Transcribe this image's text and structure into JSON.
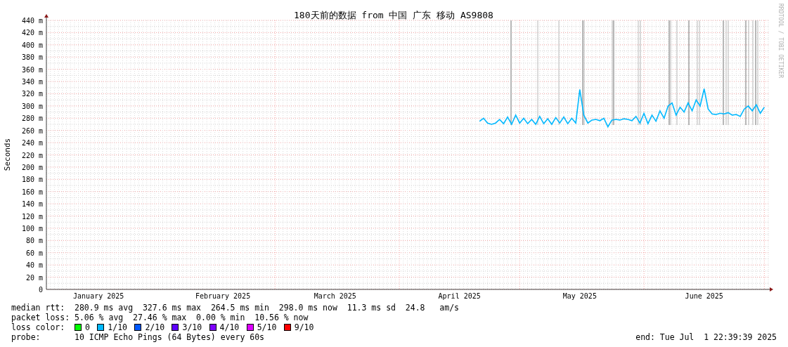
{
  "graph": {
    "credit": "RRDTOOL / TOBI OETIKER",
    "chart_data": {
      "type": "line",
      "grid": true,
      "title": "180天前的数据 from 中国 广东 移动 AS9808",
      "ylabel": "Seconds",
      "ylim": [
        0,
        440
      ],
      "yticks": [
        {
          "value": 0,
          "label": "0"
        },
        {
          "value": 20,
          "label": "20 m"
        },
        {
          "value": 40,
          "label": "40 m"
        },
        {
          "value": 60,
          "label": "60 m"
        },
        {
          "value": 80,
          "label": "80 m"
        },
        {
          "value": 100,
          "label": "100 m"
        },
        {
          "value": 120,
          "label": "120 m"
        },
        {
          "value": 140,
          "label": "140 m"
        },
        {
          "value": 160,
          "label": "160 m"
        },
        {
          "value": 180,
          "label": "180 m"
        },
        {
          "value": 200,
          "label": "200 m"
        },
        {
          "value": 220,
          "label": "220 m"
        },
        {
          "value": 240,
          "label": "240 m"
        },
        {
          "value": 260,
          "label": "260 m"
        },
        {
          "value": 280,
          "label": "280 m"
        },
        {
          "value": 300,
          "label": "300 m"
        },
        {
          "value": 320,
          "label": "320 m"
        },
        {
          "value": 340,
          "label": "340 m"
        },
        {
          "value": 360,
          "label": "360 m"
        },
        {
          "value": 380,
          "label": "380 m"
        },
        {
          "value": 400,
          "label": "400 m"
        },
        {
          "value": 420,
          "label": "420 m"
        },
        {
          "value": 440,
          "label": "440 m"
        }
      ],
      "categories": [
        null,
        null,
        null,
        null,
        null,
        null,
        null,
        null,
        null,
        null,
        null,
        null,
        null,
        "January 2025",
        null,
        null,
        null,
        null,
        null,
        null,
        null,
        null,
        null,
        null,
        null,
        null,
        null,
        null,
        null,
        null,
        null,
        null,
        null,
        null,
        null,
        null,
        null,
        null,
        null,
        null,
        null,
        null,
        null,
        null,
        "February 2025",
        null,
        null,
        null,
        null,
        null,
        null,
        null,
        null,
        null,
        null,
        null,
        null,
        null,
        null,
        null,
        null,
        null,
        null,
        null,
        null,
        null,
        null,
        null,
        null,
        null,
        null,
        null,
        "March 2025",
        null,
        null,
        null,
        null,
        null,
        null,
        null,
        null,
        null,
        null,
        null,
        null,
        null,
        null,
        null,
        null,
        null,
        null,
        null,
        null,
        null,
        null,
        null,
        null,
        null,
        null,
        null,
        null,
        null,
        null,
        "April 2025",
        null,
        null,
        null,
        null,
        null,
        null,
        null,
        null,
        null,
        null,
        null,
        null,
        null,
        null,
        null,
        null,
        null,
        null,
        null,
        null,
        null,
        null,
        null,
        null,
        null,
        null,
        null,
        null,
        null,
        "May 2025",
        null,
        null,
        null,
        null,
        null,
        null,
        null,
        null,
        null,
        null,
        null,
        null,
        null,
        null,
        null,
        null,
        null,
        null,
        null,
        null,
        null,
        null,
        null,
        null,
        null,
        null,
        null,
        null,
        null,
        null,
        "June 2025",
        null,
        null,
        null,
        null,
        null,
        null,
        null,
        null,
        null,
        null,
        null,
        null,
        null,
        null,
        null
      ],
      "series": [
        {
          "color": "#00b8ff",
          "values": [
            null,
            null,
            null,
            null,
            null,
            null,
            null,
            null,
            null,
            null,
            null,
            null,
            null,
            null,
            null,
            null,
            null,
            null,
            null,
            null,
            null,
            null,
            null,
            null,
            null,
            null,
            null,
            null,
            null,
            null,
            null,
            null,
            null,
            null,
            null,
            null,
            null,
            null,
            null,
            null,
            null,
            null,
            null,
            null,
            null,
            null,
            null,
            null,
            null,
            null,
            null,
            null,
            null,
            null,
            null,
            null,
            null,
            null,
            null,
            null,
            null,
            null,
            null,
            null,
            null,
            null,
            null,
            null,
            null,
            null,
            null,
            null,
            null,
            null,
            null,
            null,
            null,
            null,
            null,
            null,
            null,
            null,
            null,
            null,
            null,
            null,
            null,
            null,
            null,
            null,
            null,
            null,
            null,
            null,
            null,
            null,
            null,
            null,
            null,
            null,
            null,
            null,
            null,
            null,
            null,
            null,
            null,
            null,
            275,
            280,
            272,
            270,
            272,
            278,
            271,
            282,
            270,
            285,
            272,
            280,
            271,
            278,
            270,
            283,
            271,
            279,
            270,
            281,
            272,
            282,
            271,
            280,
            272,
            327,
            285,
            272,
            277,
            278,
            276,
            280,
            266,
            277,
            278,
            277,
            279,
            278,
            276,
            283,
            272,
            288,
            271,
            285,
            275,
            292,
            280,
            300,
            305,
            285,
            298,
            290,
            305,
            292,
            310,
            300,
            328,
            295,
            287,
            286,
            288,
            287,
            289,
            285,
            286,
            283,
            295,
            300,
            292,
            302,
            288,
            298
          ]
        }
      ]
    }
  },
  "legend": {
    "median_rtt": {
      "label": "median rtt:",
      "values": [
        "280.9 ms avg",
        "327.6 ms max",
        "264.5 ms min",
        "298.0 ms now",
        "11.3 ms sd",
        "24.8   am/s"
      ]
    },
    "packet_loss": {
      "label": "packet loss:",
      "values": [
        "5.06 % avg",
        "27.46 % max",
        "0.00 % min",
        "10.56 % now"
      ]
    },
    "loss_color": {
      "label": "loss color:",
      "items": [
        {
          "label": "0",
          "color": "#00ff00"
        },
        {
          "label": "1/10",
          "color": "#00b8ff"
        },
        {
          "label": "2/10",
          "color": "#0059ff"
        },
        {
          "label": "3/10",
          "color": "#5e00ff"
        },
        {
          "label": "4/10",
          "color": "#7e00ff"
        },
        {
          "label": "5/10",
          "color": "#dd00ff"
        },
        {
          "label": "9/10",
          "color": "#ff0000"
        }
      ]
    },
    "probe": {
      "label": "probe:",
      "value": "10 ICMP Echo Pings (64 Bytes) every 60s"
    },
    "end": "end: Tue Jul  1 22:39:39 2025"
  }
}
